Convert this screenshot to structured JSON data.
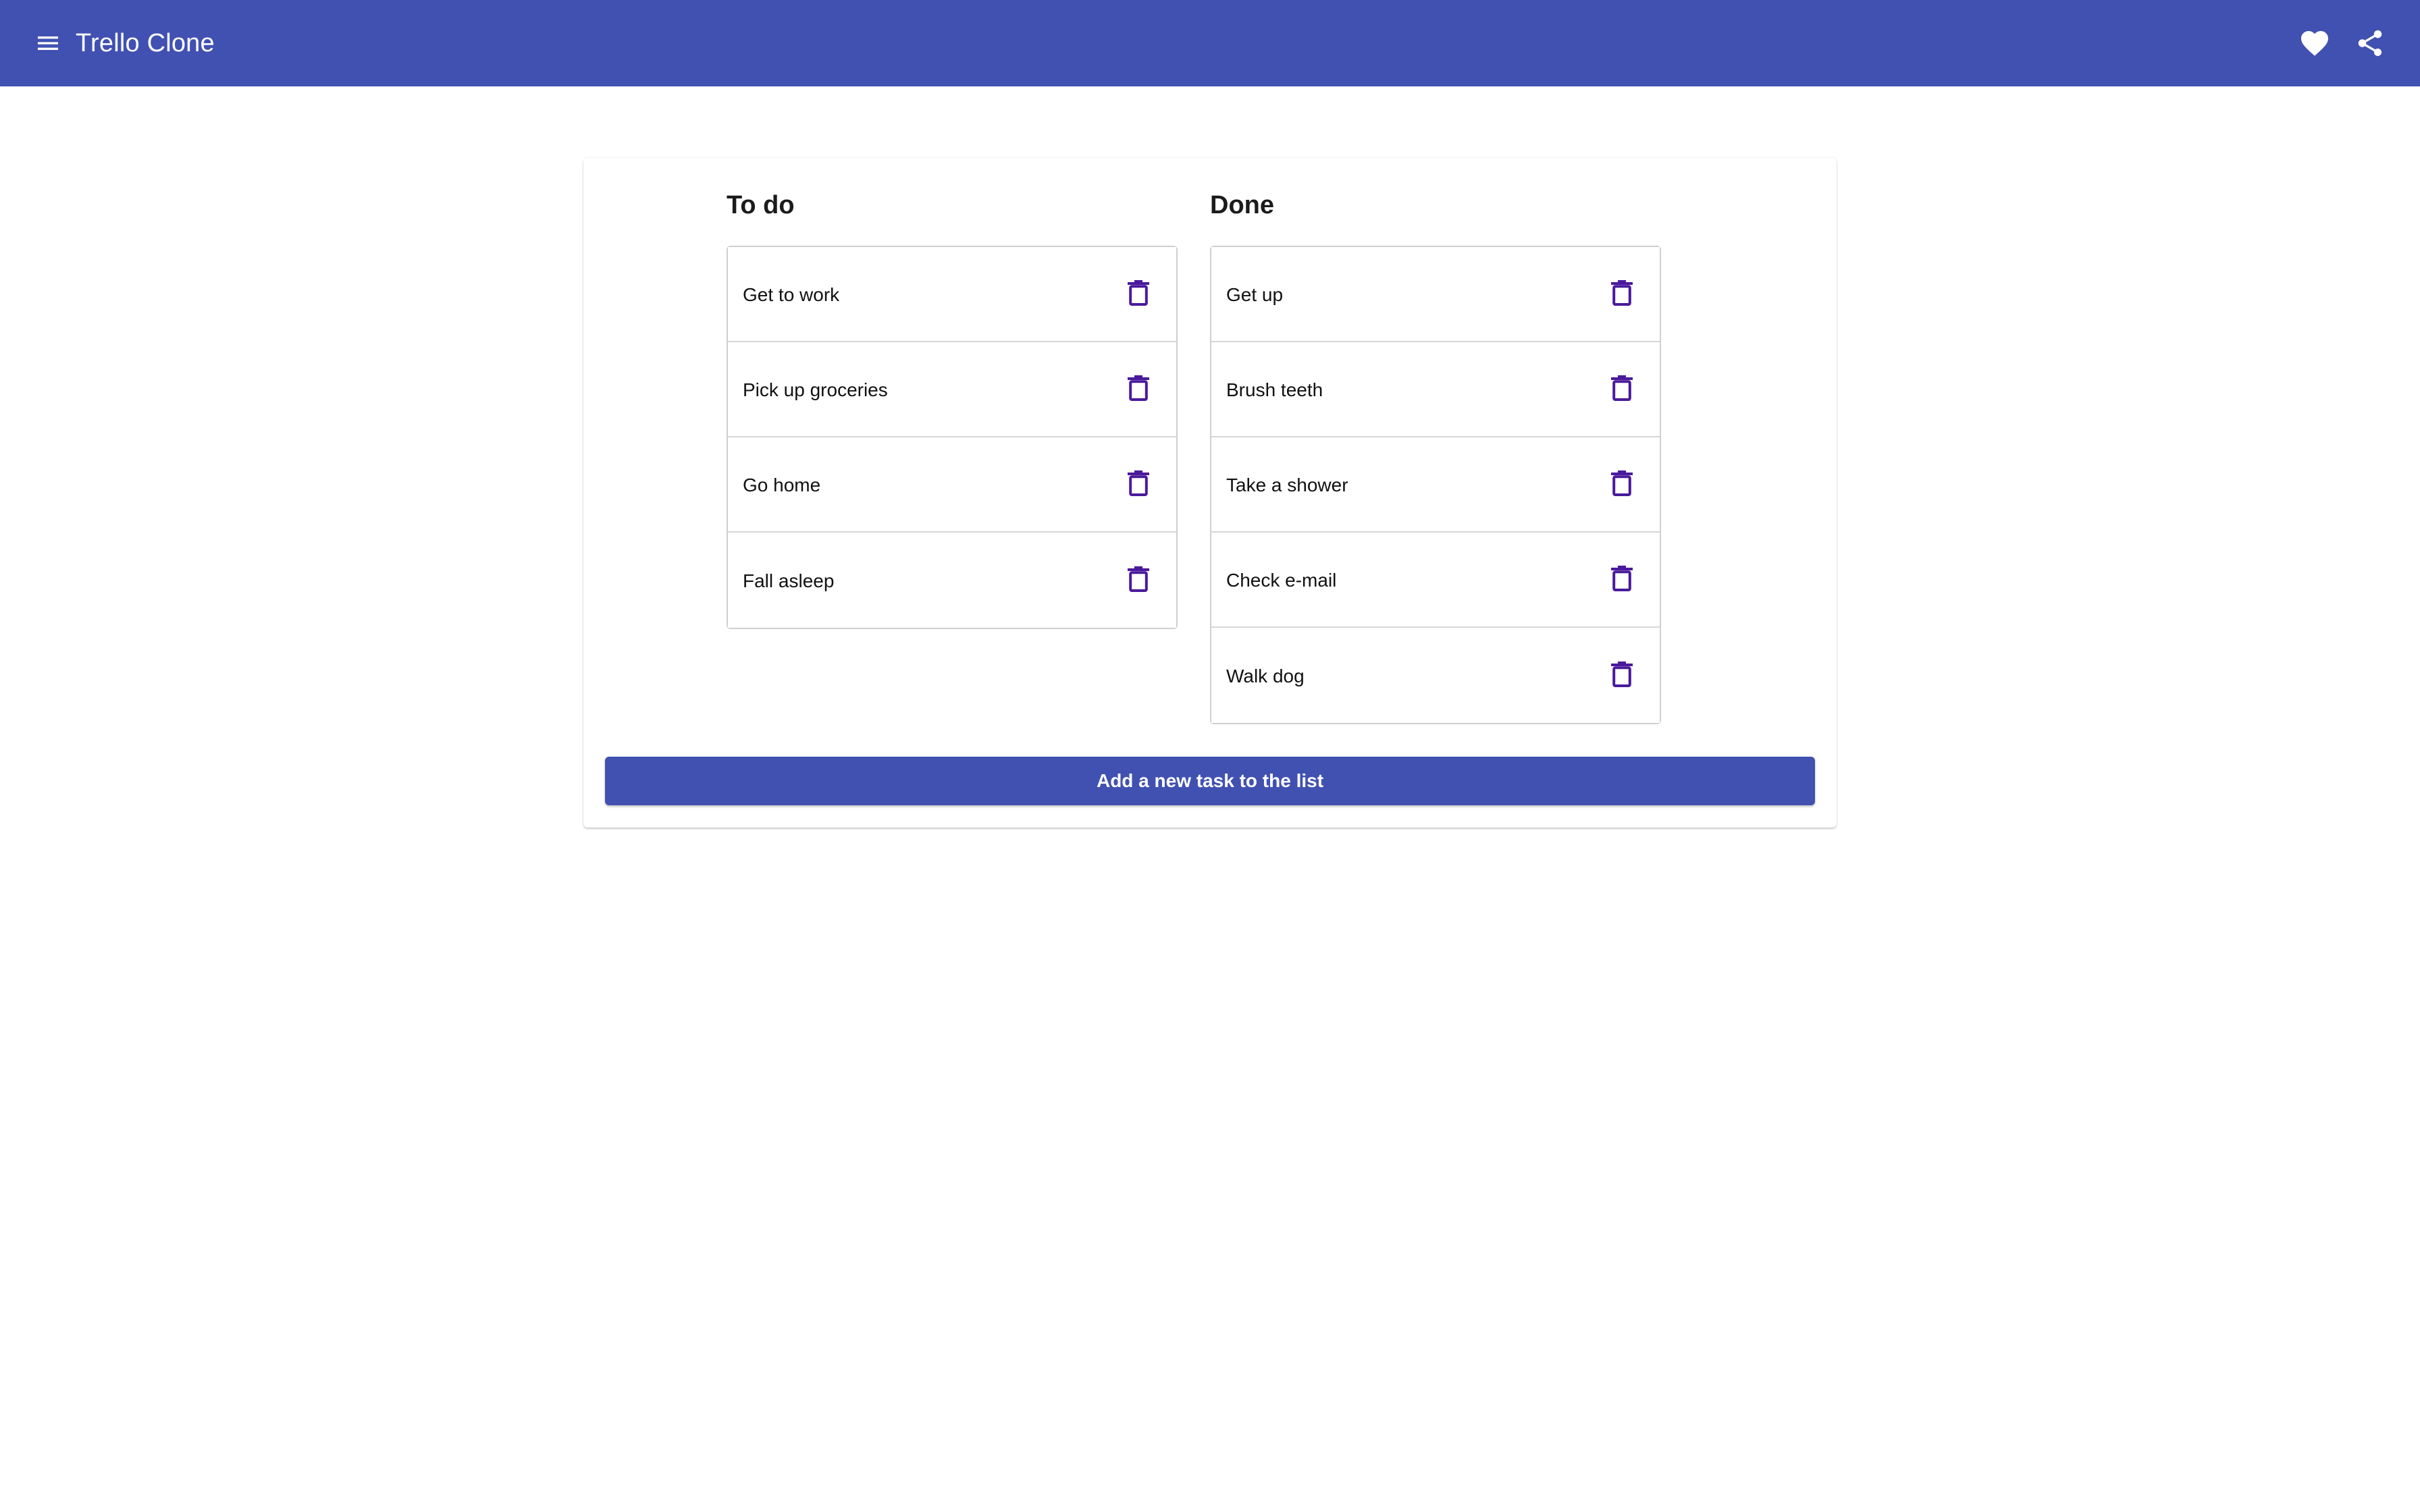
{
  "app": {
    "title": "Trello Clone",
    "brand_color": "#4151b1"
  },
  "toolbar": {
    "menu_icon": "menu-icon",
    "favorite_icon": "heart-icon",
    "share_icon": "share-icon"
  },
  "board": {
    "columns": [
      {
        "title": "To do",
        "tasks": [
          {
            "label": "Get to work"
          },
          {
            "label": "Pick up groceries"
          },
          {
            "label": "Go home"
          },
          {
            "label": "Fall asleep"
          }
        ]
      },
      {
        "title": "Done",
        "tasks": [
          {
            "label": "Get up"
          },
          {
            "label": "Brush teeth"
          },
          {
            "label": "Take a shower"
          },
          {
            "label": "Check e-mail"
          },
          {
            "label": "Walk dog"
          }
        ]
      }
    ],
    "delete_icon": "trash-icon",
    "delete_icon_color": "#4a1a9c",
    "add_button_label": "Add a new task to the list"
  }
}
